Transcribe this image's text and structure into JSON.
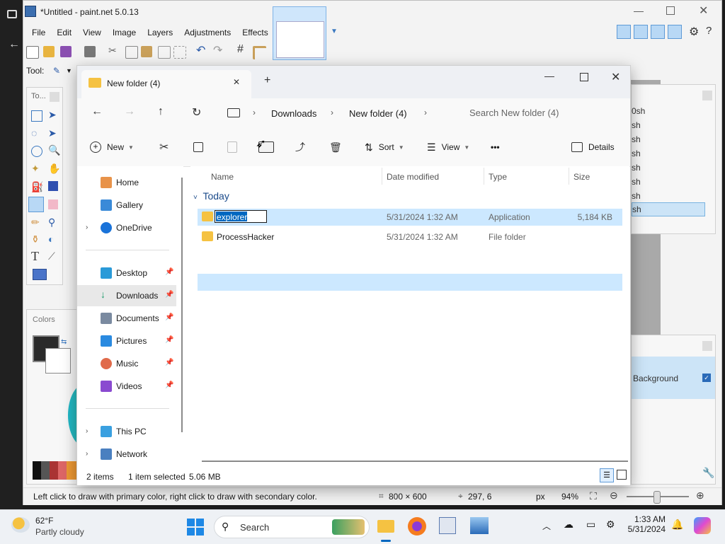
{
  "paintnet": {
    "title": "*Untitled - paint.net 5.0.13",
    "menu": [
      "File",
      "Edit",
      "View",
      "Image",
      "Layers",
      "Adjustments",
      "Effects"
    ],
    "tool_label": "Tool:",
    "tools_panel_title": "To...",
    "colors_panel_title": "Colors",
    "history_items": [
      "0sh",
      "sh",
      "sh",
      "sh",
      "sh",
      "sh",
      "sh",
      "sh"
    ],
    "layer_name": "Background",
    "status": {
      "hint": "Left click to draw with primary color, right click to draw with secondary color.",
      "size": "800 × 600",
      "cursor": "297, 6",
      "unit": "px",
      "zoom": "94%"
    }
  },
  "explorer": {
    "tab_title": "New folder (4)",
    "new_tab": "+",
    "breadcrumb": [
      "Downloads",
      "New folder (4)"
    ],
    "search_placeholder": "Search New folder (4)",
    "commands": {
      "new": "New",
      "sort": "Sort",
      "view": "View",
      "more": "•••",
      "details": "Details"
    },
    "columns": {
      "name": "Name",
      "date": "Date modified",
      "type": "Type",
      "size": "Size"
    },
    "group": "Today",
    "files": [
      {
        "name": "explorer",
        "date": "5/31/2024 1:32 AM",
        "type": "Application",
        "size": "5,184 KB",
        "selected": true
      },
      {
        "name": "ProcessHacker",
        "date": "5/31/2024 1:32 AM",
        "type": "File folder",
        "size": "",
        "selected": false
      }
    ],
    "sidebar": {
      "top": [
        "Home",
        "Gallery",
        "OneDrive"
      ],
      "quick": [
        "Desktop",
        "Downloads",
        "Documents",
        "Pictures",
        "Music",
        "Videos"
      ],
      "bottom": [
        "This PC",
        "Network"
      ]
    },
    "status": {
      "count": "2 items",
      "selected": "1 item selected",
      "size": "5.06 MB"
    }
  },
  "taskbar": {
    "weather_temp": "62°F",
    "weather_desc": "Partly cloudy",
    "search": "Search",
    "time": "1:33 AM",
    "date": "5/31/2024"
  },
  "colors": {
    "accent": "#0067c0",
    "selection": "#cce8ff",
    "folder": "#f5c242"
  }
}
